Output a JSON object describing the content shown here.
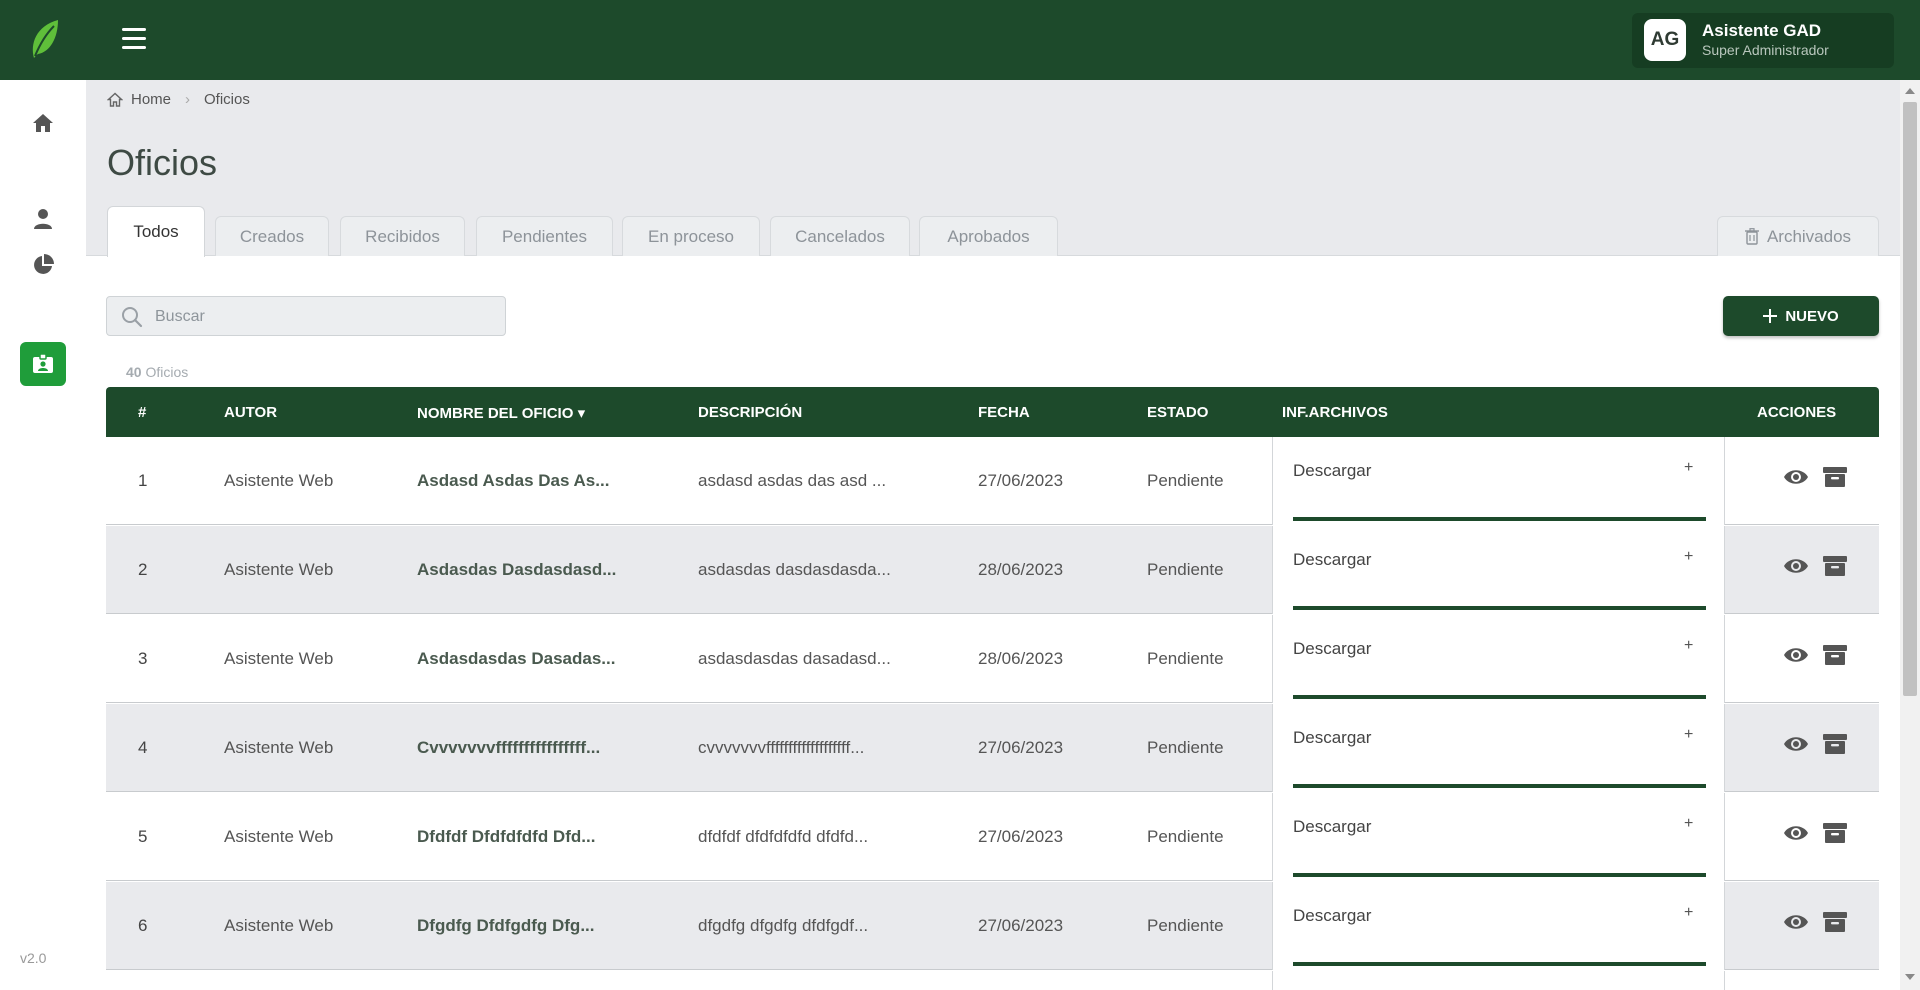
{
  "header": {
    "user_initials": "AG",
    "user_name": "Asistente GAD",
    "user_role": "Super Administrador"
  },
  "sidebar": {
    "icons": [
      "home-icon",
      "user-icon",
      "pie-chart-icon",
      "id-badge-icon"
    ],
    "version": "v2.0"
  },
  "breadcrumb": {
    "home": "Home",
    "current": "Oficios"
  },
  "page": {
    "title": "Oficios"
  },
  "tabs": [
    "Todos",
    "Creados",
    "Recibidos",
    "Pendientes",
    "En proceso",
    "Cancelados",
    "Aprobados"
  ],
  "archived_tab": "Archivados",
  "search": {
    "placeholder": "Buscar"
  },
  "new_button": "NUEVO",
  "count": {
    "value": "40",
    "label": "Oficios"
  },
  "table": {
    "headers": [
      "#",
      "AUTOR",
      "NOMBRE DEL OFICIO",
      "DESCRIPCIÓN",
      "FECHA",
      "ESTADO",
      "INF.ARCHIVOS",
      "ACCIONES"
    ],
    "sort_indicator": "▾",
    "download_label": "Descargar",
    "expand_symbol": "+",
    "rows": [
      {
        "n": "1",
        "autor": "Asistente Web",
        "nombre": "Asdasd Asdas Das As...",
        "desc": "asdasd asdas das asd ...",
        "fecha": "27/06/2023",
        "estado": "Pendiente"
      },
      {
        "n": "2",
        "autor": "Asistente Web",
        "nombre": "Asdasdas Dasdasdasd...",
        "desc": "asdasdas dasdasdasda...",
        "fecha": "28/06/2023",
        "estado": "Pendiente"
      },
      {
        "n": "3",
        "autor": "Asistente Web",
        "nombre": "Asdasdasdas Dasadas...",
        "desc": "asdasdasdas dasadasd...",
        "fecha": "28/06/2023",
        "estado": "Pendiente"
      },
      {
        "n": "4",
        "autor": "Asistente Web",
        "nombre": "Cvvvvvvvffffffffffffffff...",
        "desc": "cvvvvvvvfffffffffffffffffff...",
        "fecha": "27/06/2023",
        "estado": "Pendiente"
      },
      {
        "n": "5",
        "autor": "Asistente Web",
        "nombre": "Dfdfdf Dfdfdfdfd Dfd...",
        "desc": "dfdfdf dfdfdfdfd dfdfd...",
        "fecha": "27/06/2023",
        "estado": "Pendiente"
      },
      {
        "n": "6",
        "autor": "Asistente Web",
        "nombre": "Dfgdfg Dfdfgdfg Dfg...",
        "desc": "dfgdfg dfgdfg dfdfgdf...",
        "fecha": "27/06/2023",
        "estado": "Pendiente"
      }
    ]
  },
  "colors": {
    "primary": "#1d4a2b",
    "accent": "#1f9d3a",
    "background": "#e9eaed"
  }
}
